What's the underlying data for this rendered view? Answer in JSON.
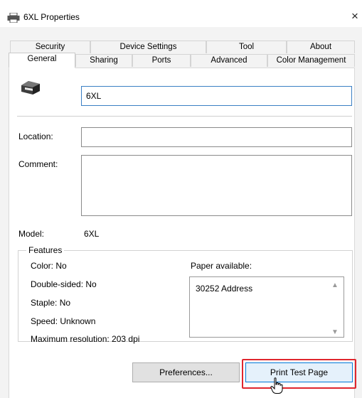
{
  "window": {
    "title": "6XL Properties",
    "close_glyph": "×"
  },
  "tabs_row1": [
    "Security",
    "Device Settings",
    "Tool",
    "About"
  ],
  "tabs_row2": [
    "General",
    "Sharing",
    "Ports",
    "Advanced",
    "Color Management"
  ],
  "selected_tab": "General",
  "printer": {
    "name": "6XL",
    "icon": "printer-icon"
  },
  "location": {
    "label": "Location:",
    "value": ""
  },
  "comment": {
    "label": "Comment:",
    "value": ""
  },
  "model": {
    "label": "Model:",
    "value": "6XL"
  },
  "features": {
    "title": "Features",
    "color": "Color: No",
    "double_sided": "Double-sided: No",
    "staple": "Staple: No",
    "speed": "Speed: Unknown",
    "max_resolution": "Maximum resolution: 203 dpi",
    "paper_label": "Paper available:",
    "paper_items": [
      "30252 Address"
    ]
  },
  "buttons": {
    "preferences": "Preferences...",
    "print_test": "Print Test Page"
  },
  "colors": {
    "accent": "#0078d7",
    "highlight": "#e0262e"
  }
}
